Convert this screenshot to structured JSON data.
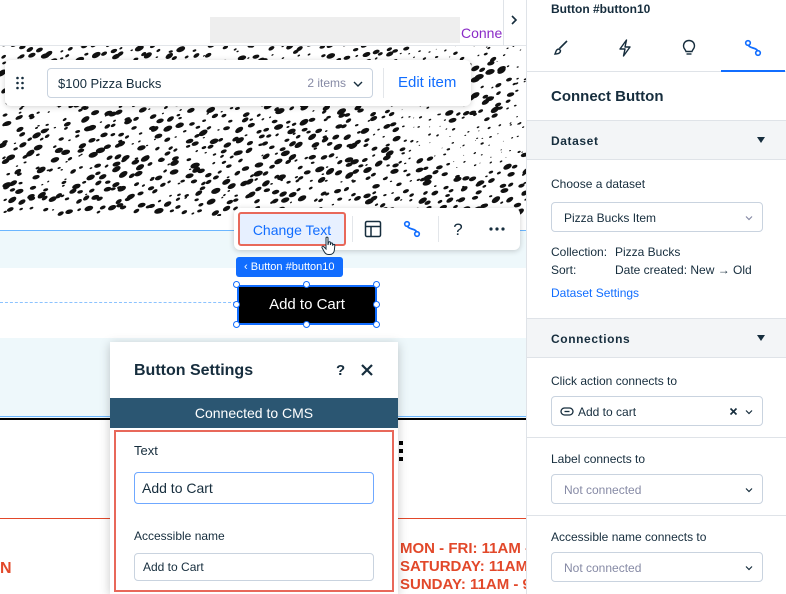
{
  "topbar": {
    "connect_text": "Conne"
  },
  "repeater": {
    "item_name": "$100 Pizza Bucks",
    "item_count": "2 items",
    "edit_item": "Edit item"
  },
  "toolbar": {
    "change_text": "Change Text"
  },
  "element": {
    "tag": "Button #button10",
    "label": "Add to Cart"
  },
  "settings": {
    "title": "Button Settings",
    "help": "?",
    "connected": "Connected to CMS",
    "text_label": "Text",
    "text_value": "Add to Cart",
    "acc_label": "Accessible name",
    "acc_value": "Add to Cart"
  },
  "canvas_text": {
    "red_n": "N",
    "hours": [
      "MON - FRI: 11AM -",
      "SATURDAY: 11AM -",
      "SUNDAY: 11AM - 9"
    ]
  },
  "inspector": {
    "title": "Button #button10",
    "panel_title": "Connect Button",
    "dataset": {
      "header": "Dataset",
      "choose_label": "Choose a dataset",
      "selected": "Pizza Bucks Item",
      "collection_label": "Collection:",
      "collection_value": "Pizza Bucks",
      "sort_label": "Sort:",
      "sort_value": "Date created: New → Old",
      "settings_link": "Dataset Settings"
    },
    "connections": {
      "header": "Connections",
      "click_label": "Click action connects to",
      "click_value": "Add to cart",
      "label_label": "Label connects to",
      "label_value": "Not connected",
      "acc_label": "Accessible name connects to",
      "acc_value": "Not connected"
    }
  },
  "colors": {
    "accent": "#116dff",
    "highlight": "#e8685a",
    "cms_bar": "#2b5672",
    "hours_red": "#e2482a"
  }
}
